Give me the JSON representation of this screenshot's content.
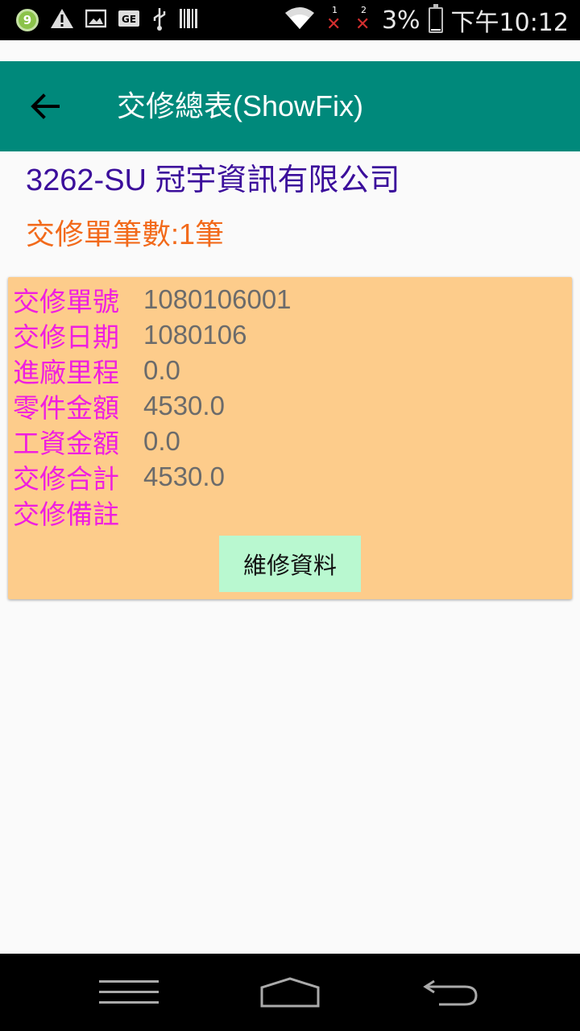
{
  "status_bar": {
    "notification_count": "9",
    "battery_percent": "3%",
    "time": "下午10:12",
    "sim1_label": "1",
    "sim2_label": "2",
    "sim_no_signal": "✕"
  },
  "app_bar": {
    "title": "交修總表(ShowFix)"
  },
  "company": "3262-SU 冠宇資訊有限公司",
  "fix_count": "交修單筆數:1筆",
  "fix_card": {
    "rows": [
      {
        "label": "交修單號",
        "value": "1080106001"
      },
      {
        "label": "交修日期",
        "value": "1080106"
      },
      {
        "label": "進廠里程",
        "value": "0.0"
      },
      {
        "label": "零件金額",
        "value": "4530.0"
      },
      {
        "label": "工資金額",
        "value": "0.0"
      },
      {
        "label": "交修合計",
        "value": "4530.0"
      },
      {
        "label": "交修備註",
        "value": ""
      }
    ],
    "button_label": "維修資料"
  },
  "colors": {
    "app_bar": "#00897b",
    "company_text": "#3b0e9b",
    "count_text": "#f26a1b",
    "card_bg": "#fdcc8b",
    "label_text": "#f01ee0",
    "button_bg": "#b9f8d0"
  }
}
